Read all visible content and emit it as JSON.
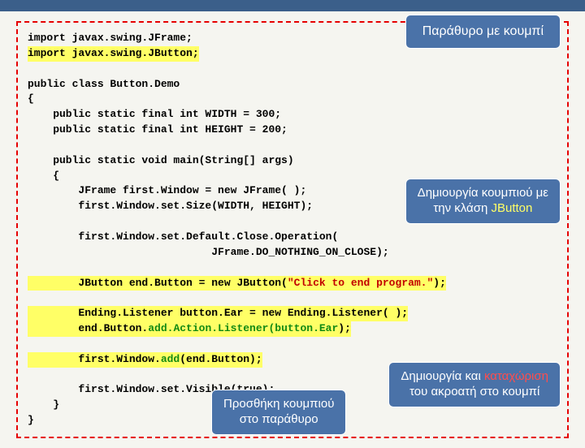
{
  "callouts": {
    "title": "Παράθυρο με κουμπί",
    "jbutton_line1": "Δημιουργία κουμπιού με",
    "jbutton_line2_a": "την κλάση ",
    "jbutton_line2_b": "JButton",
    "add_line1": "Προσθήκη κουμπιού",
    "add_line2": "στο παράθυρο",
    "listener_line1_a": "Δημιουργία και ",
    "listener_line1_b": "καταχώριση",
    "listener_line2": "του ακροατή στο κουμπί"
  },
  "code": {
    "l01": "import javax.swing.JFrame;",
    "l02": "import javax.swing.JButton;",
    "l04": "public class Button.Demo",
    "l05": "{",
    "l06": "    public static final int WIDTH = 300;",
    "l07": "    public static final int HEIGHT = 200;",
    "l09": "    public static void main(String[] args)",
    "l10": "    {",
    "l11": "        JFrame first.Window = new JFrame( );",
    "l12": "        first.Window.set.Size(WIDTH, HEIGHT);",
    "l14": "        first.Window.set.Default.Close.Operation(",
    "l15": "                             JFrame.DO_NOTHING_ON_CLOSE);",
    "l17a": "        JButton end.Button = new JButton(",
    "l17b": "\"Click to end program.\"",
    "l17c": ");",
    "l19a": "        Ending.Listener button.Ear = new Ending.Listener( );",
    "l20a": "        end.Button.",
    "l20b": "add.Action.Listener(",
    "l20c": "button.Ear",
    "l20d": ");",
    "l22a": "        first.Window.",
    "l22b": "add",
    "l22c": "(end.Button);",
    "l24": "        first.Window.set.Visible(true);",
    "l25": "    }",
    "l26": "}"
  }
}
